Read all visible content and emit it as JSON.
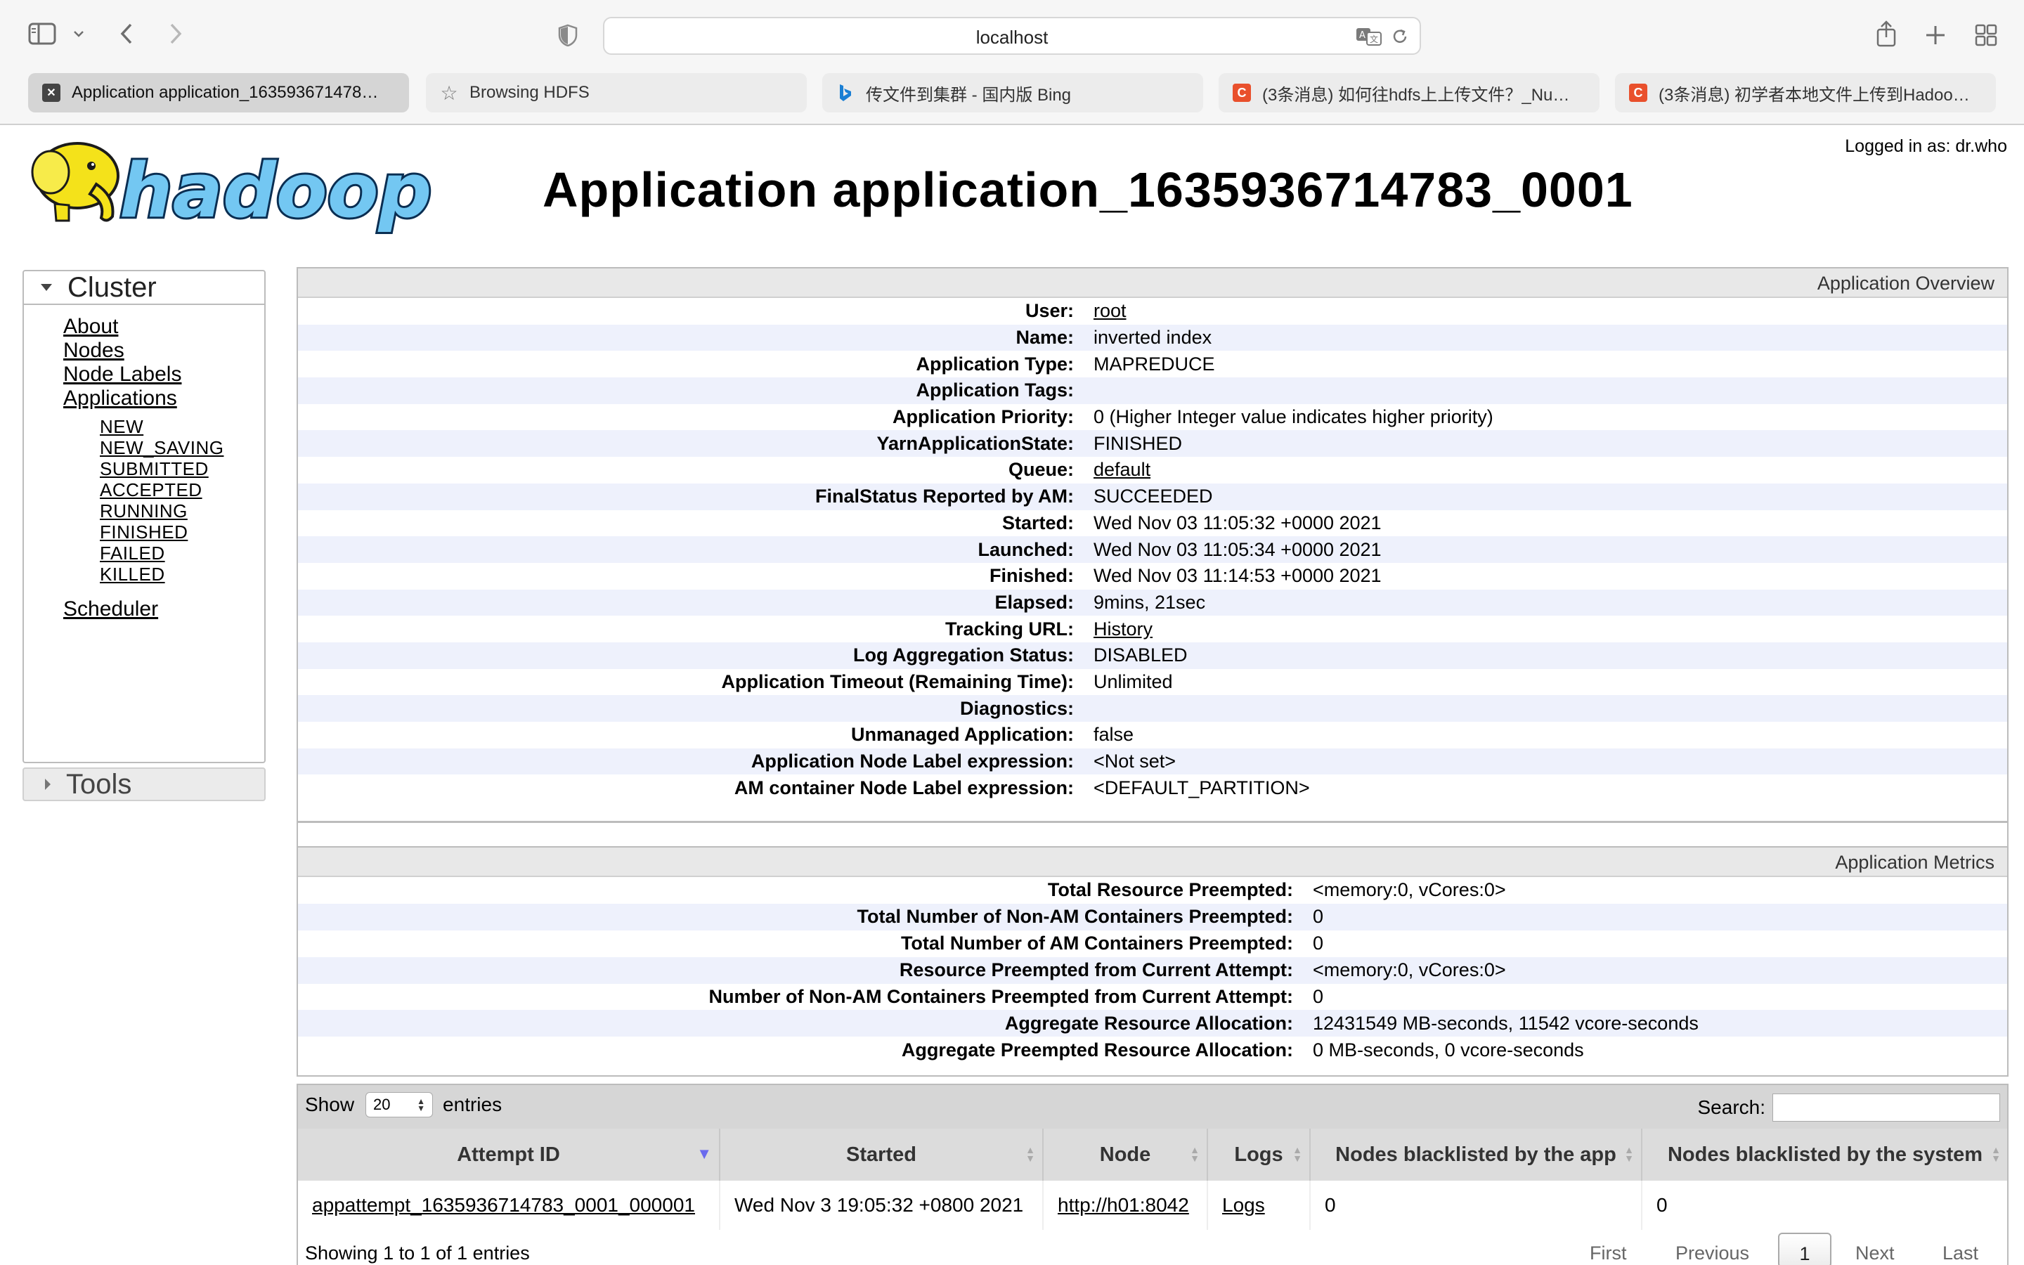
{
  "browser": {
    "address": "localhost",
    "tabs": [
      {
        "label": "Application application_163593671478…",
        "icon": "hadoop-favicon-icon",
        "active": true
      },
      {
        "label": "Browsing HDFS",
        "icon": "star-icon",
        "active": false
      },
      {
        "label": "传文件到集群 - 国内版 Bing",
        "icon": "bing-icon",
        "active": false
      },
      {
        "label": "(3条消息) 如何往hdfs上上传文件？_Nu…",
        "icon": "csdn-icon",
        "active": false
      },
      {
        "label": "(3条消息) 初学者本地文件上传到Hadoo…",
        "icon": "csdn-icon",
        "active": false
      }
    ]
  },
  "header": {
    "logged_in": "Logged in as: dr.who",
    "title": "Application application_1635936714783_0001",
    "logo_text": "hadoop"
  },
  "nav": {
    "cluster_label": "Cluster",
    "tools_label": "Tools",
    "links": [
      "About",
      "Nodes",
      "Node Labels",
      "Applications"
    ],
    "app_states": [
      "NEW",
      "NEW_SAVING",
      "SUBMITTED",
      "ACCEPTED",
      "RUNNING",
      "FINISHED",
      "FAILED",
      "KILLED"
    ],
    "scheduler": "Scheduler"
  },
  "overview": {
    "caption": "Application Overview",
    "rows": [
      {
        "key": "User:",
        "value": "root",
        "link": true
      },
      {
        "key": "Name:",
        "value": "inverted index"
      },
      {
        "key": "Application Type:",
        "value": "MAPREDUCE"
      },
      {
        "key": "Application Tags:",
        "value": ""
      },
      {
        "key": "Application Priority:",
        "value": "0 (Higher Integer value indicates higher priority)"
      },
      {
        "key": "YarnApplicationState:",
        "value": "FINISHED"
      },
      {
        "key": "Queue:",
        "value": "default",
        "link": true
      },
      {
        "key": "FinalStatus Reported by AM:",
        "value": "SUCCEEDED"
      },
      {
        "key": "Started:",
        "value": "Wed Nov 03 11:05:32 +0000 2021"
      },
      {
        "key": "Launched:",
        "value": "Wed Nov 03 11:05:34 +0000 2021"
      },
      {
        "key": "Finished:",
        "value": "Wed Nov 03 11:14:53 +0000 2021"
      },
      {
        "key": "Elapsed:",
        "value": "9mins, 21sec"
      },
      {
        "key": "Tracking URL:",
        "value": "History",
        "link": true
      },
      {
        "key": "Log Aggregation Status:",
        "value": "DISABLED"
      },
      {
        "key": "Application Timeout (Remaining Time):",
        "value": "Unlimited"
      },
      {
        "key": "Diagnostics:",
        "value": ""
      },
      {
        "key": "Unmanaged Application:",
        "value": "false"
      },
      {
        "key": "Application Node Label expression:",
        "value": "<Not set>"
      },
      {
        "key": "AM container Node Label expression:",
        "value": "<DEFAULT_PARTITION>"
      }
    ]
  },
  "metrics": {
    "caption": "Application Metrics",
    "rows": [
      {
        "key": "Total Resource Preempted:",
        "value": "<memory:0, vCores:0>"
      },
      {
        "key": "Total Number of Non-AM Containers Preempted:",
        "value": "0"
      },
      {
        "key": "Total Number of AM Containers Preempted:",
        "value": "0"
      },
      {
        "key": "Resource Preempted from Current Attempt:",
        "value": "<memory:0, vCores:0>"
      },
      {
        "key": "Number of Non-AM Containers Preempted from Current Attempt:",
        "value": "0"
      },
      {
        "key": "Aggregate Resource Allocation:",
        "value": "12431549 MB-seconds, 11542 vcore-seconds"
      },
      {
        "key": "Aggregate Preempted Resource Allocation:",
        "value": "0 MB-seconds, 0 vcore-seconds"
      }
    ]
  },
  "attempts": {
    "show_label": "Show",
    "entries_label": "entries",
    "page_size": "20",
    "search_label": "Search:",
    "search_value": "",
    "columns": [
      "Attempt ID",
      "Started",
      "Node",
      "Logs",
      "Nodes blacklisted by the app",
      "Nodes blacklisted by the system"
    ],
    "rows": [
      [
        "appattempt_1635936714783_0001_000001",
        "Wed Nov 3 19:05:32 +0800 2021",
        "http://h01:8042",
        "Logs",
        "0",
        "0"
      ]
    ],
    "showing": "Showing 1 to 1 of 1 entries",
    "pager": {
      "first": "First",
      "previous": "Previous",
      "current": "1",
      "next": "Next",
      "last": "Last"
    }
  }
}
